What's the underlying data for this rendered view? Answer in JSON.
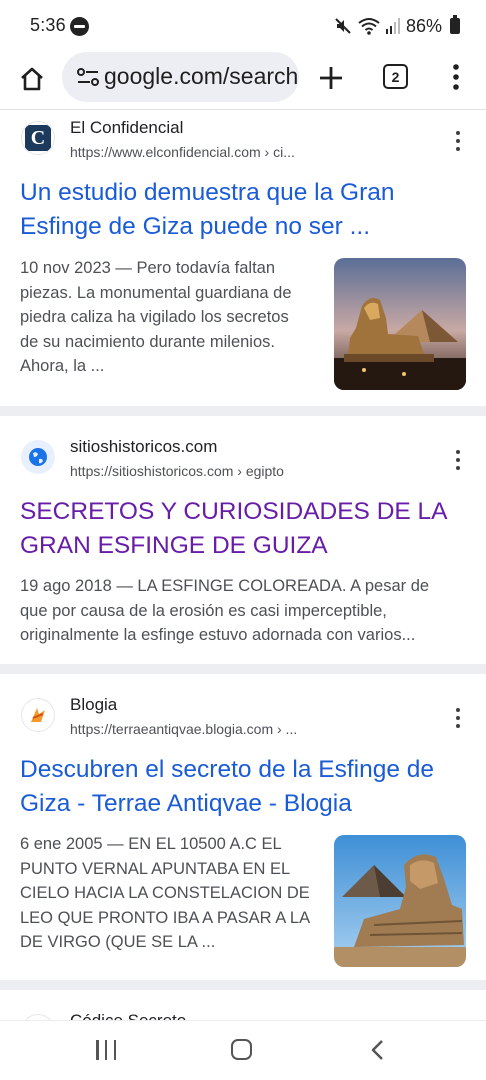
{
  "status_bar": {
    "time": "5:36",
    "battery": "86%"
  },
  "browser": {
    "url": "google.com/search",
    "tab_count": "2"
  },
  "results": [
    {
      "site_name": "El Confidencial",
      "url": "https://www.elconfidencial.com › ci...",
      "title_line1": "Un estudio demuestra que la Gran",
      "title_line2": "Esfinge de Giza puede no ser ...",
      "visited": false,
      "logo_letter": "C",
      "snippet": [
        "10 nov 2023 — Pero todavía faltan",
        "piezas. La monumental guardiana de",
        "piedra caliza ha vigilado los secretos",
        "de su nacimiento durante milenios.",
        "Ahora, la ..."
      ]
    },
    {
      "site_name": "sitioshistoricos.com",
      "url": "https://sitioshistoricos.com › egipto",
      "title_line1": "SECRETOS Y CURIOSIDADES DE LA",
      "title_line2": "GRAN ESFINGE DE GUIZA",
      "visited": true,
      "snippet": [
        "19 ago 2018 — LA ESFINGE COLOREADA. A pesar de",
        "que por causa de la erosión es casi imperceptible,",
        "originalmente la esfinge estuvo adornada con varios..."
      ]
    },
    {
      "site_name": "Blogia",
      "url": "https://terraeantiqvae.blogia.com › ...",
      "title_line1": "Descubren el secreto de la Esfinge de",
      "title_line2": "Giza - Terrae Antiqvae - Blogia",
      "visited": false,
      "snippet": [
        "6 ene 2005 — EN EL 10500 A.C EL",
        "PUNTO VERNAL APUNTABA EN EL",
        "CIELO HACIA LA CONSTELACION DE",
        "LEO QUE PRONTO IBA A PASAR A LA",
        "DE VIRGO (QUE SE LA ..."
      ]
    },
    {
      "site_name": "Códice Secreto"
    }
  ],
  "colors": {
    "link": "#1a5bd6",
    "visited": "#681da8",
    "snippet": "#4d5156",
    "divider": "#eceef1"
  }
}
